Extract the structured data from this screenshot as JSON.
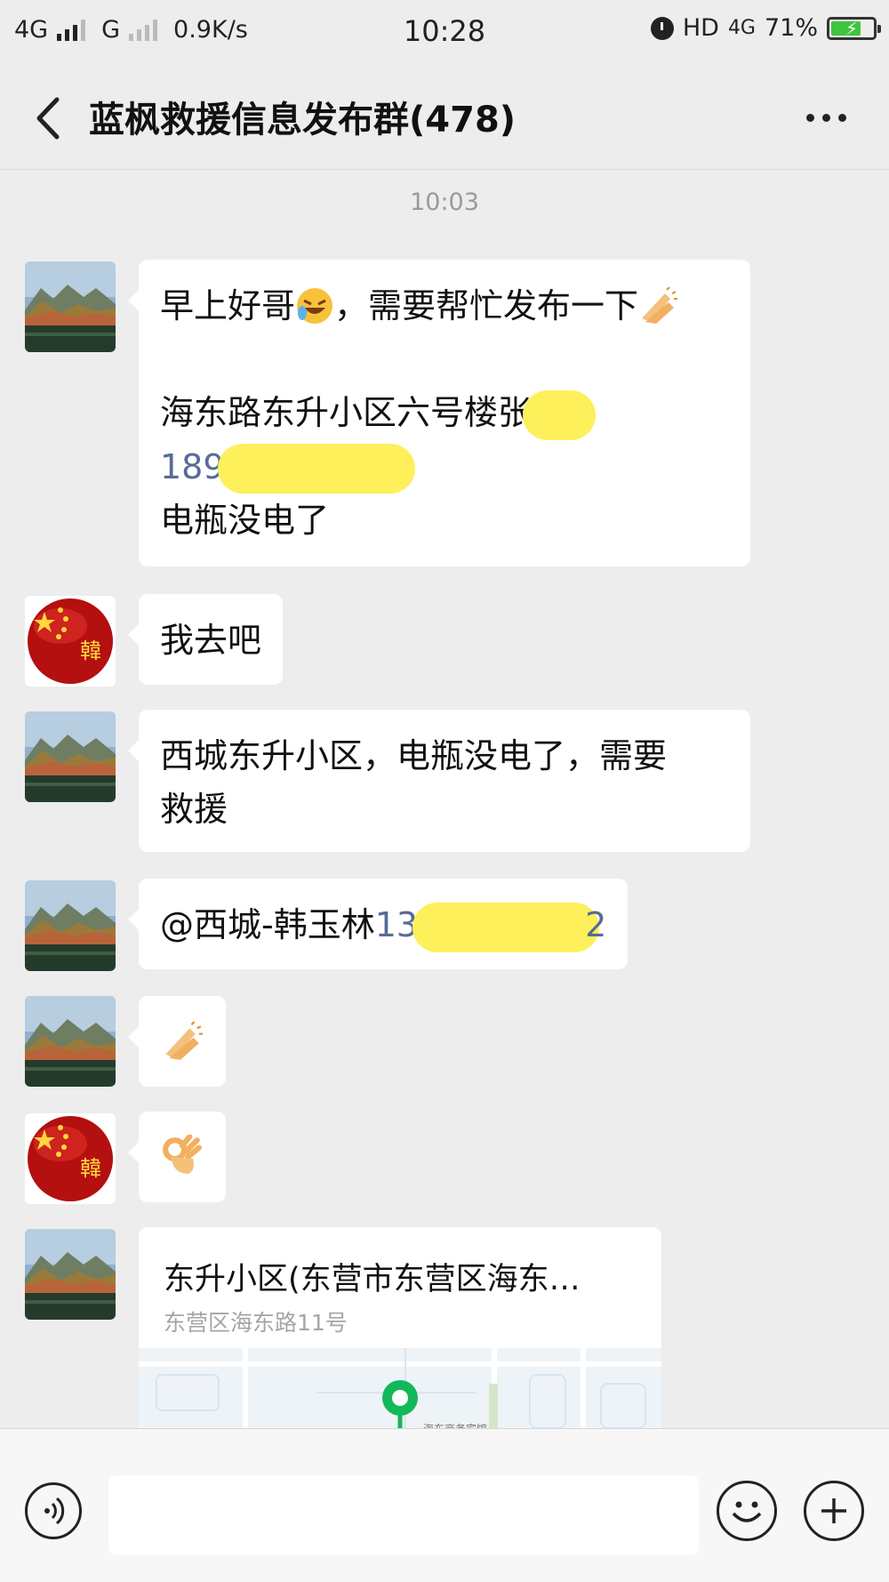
{
  "status_bar": {
    "network1": "4G",
    "network2": "G",
    "speed": "0.9K/s",
    "time": "10:28",
    "hd": "HD",
    "network3": "4G",
    "battery_percent": "71%",
    "battery_level": 0.71
  },
  "nav": {
    "title": "蓝枫救援信息发布群(478)"
  },
  "chat": {
    "timestamp": "10:03",
    "messages": [
      {
        "line1a": "早上好哥",
        "line1b": "，需要帮忙发布一下",
        "line2": "海东路东升小区六号楼张",
        "line3_phone": "189",
        "line4": "电瓶没电了"
      },
      {
        "text": "我去吧"
      },
      {
        "line1": "西城东升小区，电瓶没电了，需要",
        "line2": "救援"
      },
      {
        "mention": "@西城-韩玉林",
        "phone_start": "13",
        "phone_end": "2"
      },
      {
        "emoji": "clapping-hands-emoji"
      },
      {
        "emoji": "ok-hand-emoji"
      },
      {
        "location_title": "东升小区(东营市东营区海东…",
        "location_address": "东营区海东路11号",
        "map_label": "海东商务宾馆"
      }
    ]
  },
  "avatar_seal_char": "韓",
  "colors": {
    "background": "#ededed",
    "bubble": "#ffffff",
    "link": "#576b95",
    "redaction": "#fdf05a",
    "map_pin": "#12b85a"
  }
}
